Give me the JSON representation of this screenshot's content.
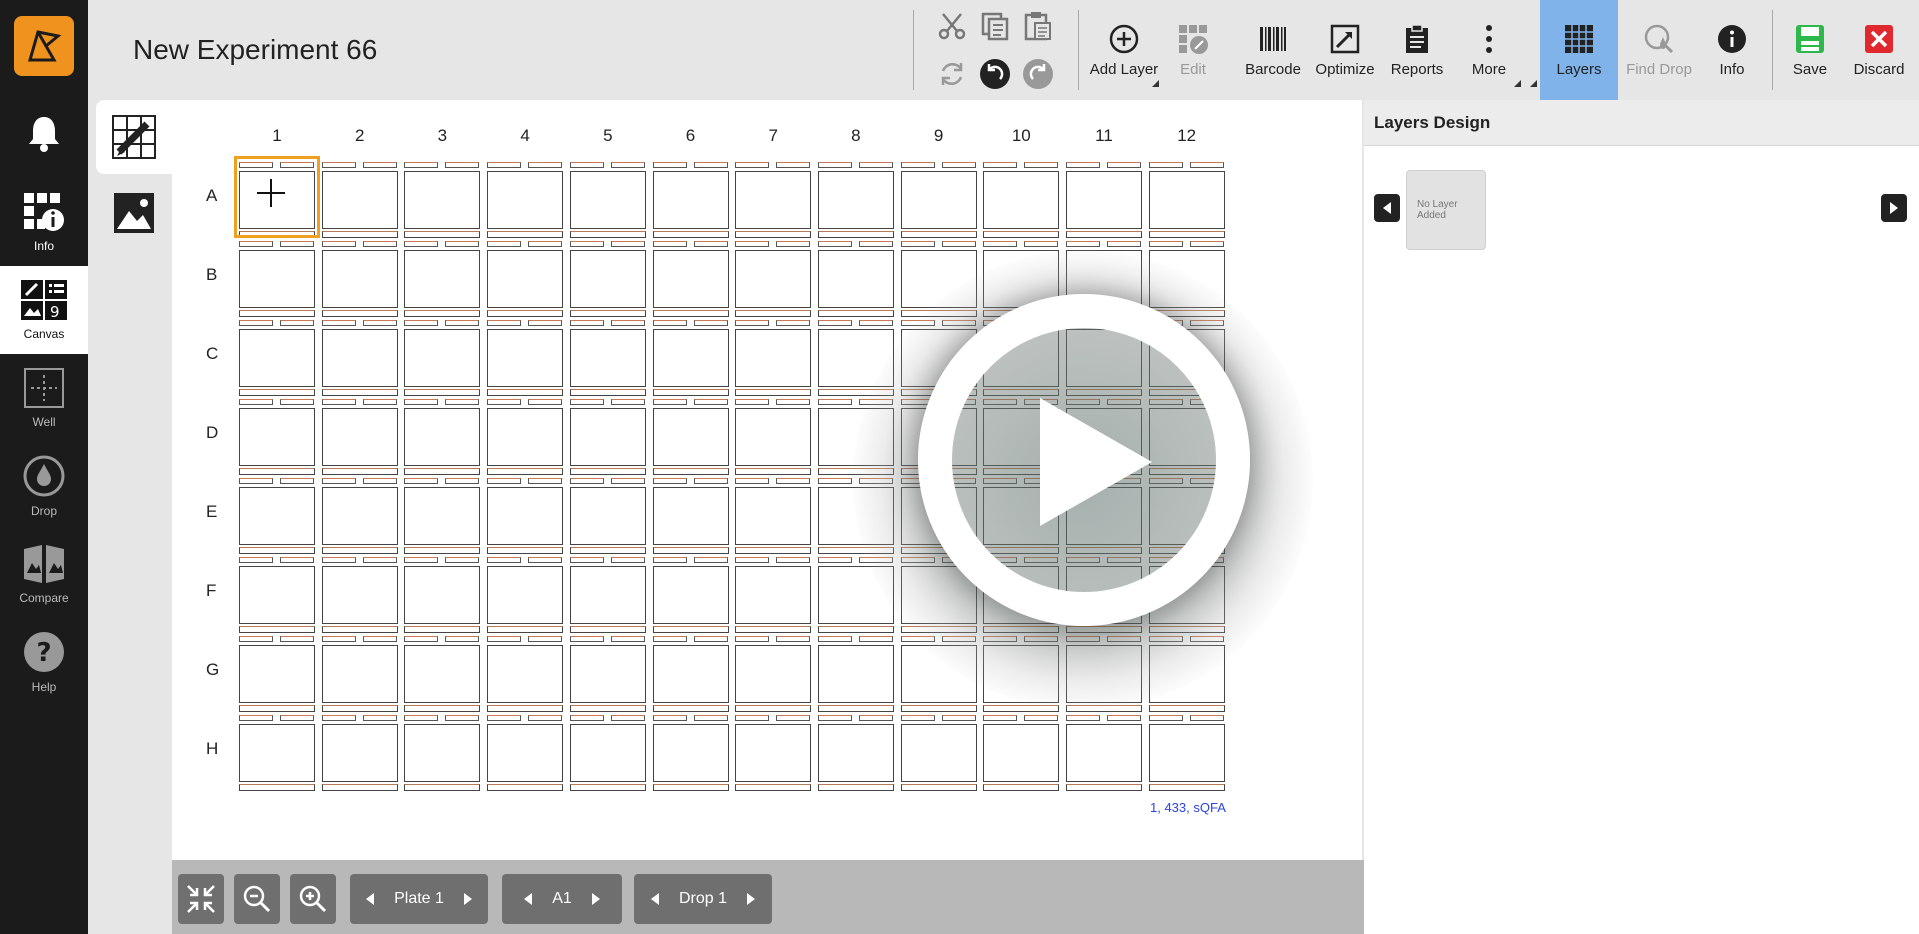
{
  "header": {
    "title": "New Experiment 66"
  },
  "sidebar": {
    "items": [
      {
        "name": "bell",
        "label": ""
      },
      {
        "name": "info",
        "label": "Info"
      },
      {
        "name": "canvas",
        "label": "Canvas"
      },
      {
        "name": "well",
        "label": "Well"
      },
      {
        "name": "drop",
        "label": "Drop"
      },
      {
        "name": "compare",
        "label": "Compare"
      },
      {
        "name": "help",
        "label": "Help"
      }
    ]
  },
  "toolbar": {
    "add_layer": "Add Layer",
    "edit": "Edit",
    "barcode": "Barcode",
    "optimize": "Optimize",
    "reports": "Reports",
    "more": "More",
    "layers": "Layers",
    "find_drop": "Find Drop",
    "info": "Info",
    "save": "Save",
    "discard": "Discard"
  },
  "plate": {
    "columns": [
      "1",
      "2",
      "3",
      "4",
      "5",
      "6",
      "7",
      "8",
      "9",
      "10",
      "11",
      "12"
    ],
    "rows": [
      "A",
      "B",
      "C",
      "D",
      "E",
      "F",
      "G",
      "H"
    ],
    "selected_well": "A1",
    "readout": "1, 433, sQFA"
  },
  "panel": {
    "title": "Layers Design",
    "empty_card": "No Layer Added"
  },
  "bottom": {
    "plate_label": "Plate 1",
    "well_label": "A1",
    "drop_label": "Drop 1"
  },
  "colors": {
    "accent": "#f0931e",
    "active_tab": "#7fb3ea",
    "save_green": "#2db84c",
    "discard_red": "#e0282e",
    "readout_blue": "#2a44e8"
  }
}
